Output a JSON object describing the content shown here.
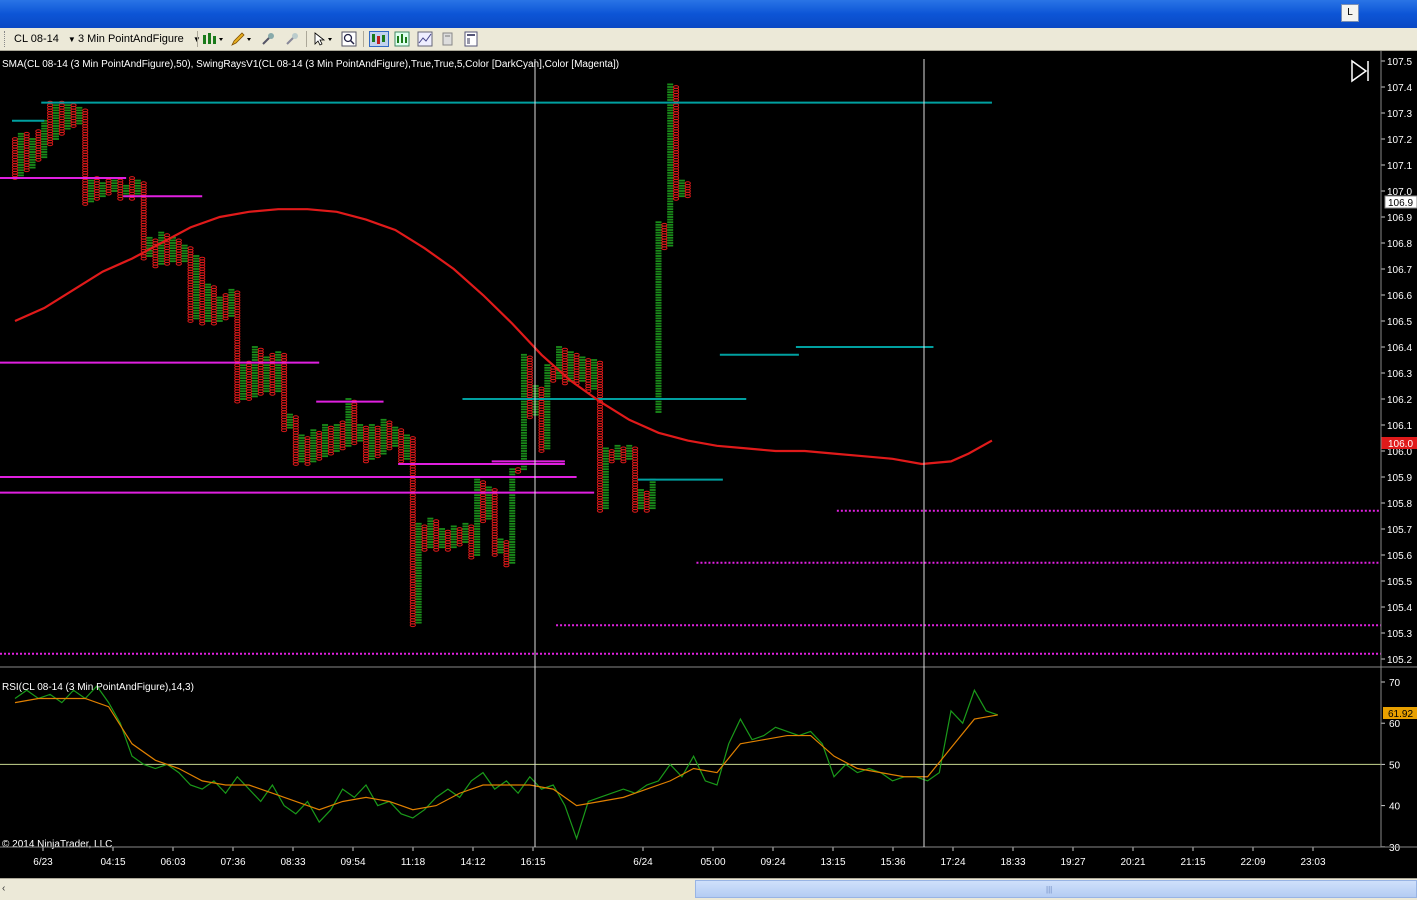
{
  "window": {
    "title_button": "L"
  },
  "toolbar": {
    "instrument": "CL 08-14",
    "period": "3 Min PointAndFigure",
    "icons": [
      "bar-chart-type-icon",
      "pencil-draw-icon",
      "crosshair-pin-icon",
      "zoom-pin-icon",
      "cursor-select-icon",
      "zoom-icon",
      "data-box-icon",
      "indicators-icon",
      "strategies-icon",
      "copy-icon",
      "properties-icon"
    ]
  },
  "price_panel": {
    "indicator_label": "SMA(CL 08-14 (3 Min PointAndFigure),50), SwingRaysV1(CL 08-14 (3 Min PointAndFigure),True,True,5,Color [DarkCyan],Color [Magenta])",
    "y_ticks": [
      "107.5",
      "107.4",
      "107.3",
      "107.2",
      "107.1",
      "107.0",
      "106.9",
      "106.8",
      "106.7",
      "106.6",
      "106.5",
      "106.4",
      "106.3",
      "106.2",
      "106.1",
      "106.0",
      "105.9",
      "105.8",
      "105.7",
      "105.6",
      "105.5",
      "105.4",
      "105.3",
      "105.2"
    ],
    "last_price_label": "106.9",
    "sma_value_label": "106.0",
    "colors": {
      "x": "#1a8c1a",
      "o": "#e01a1a",
      "sma": "#e01a1a",
      "swing_high": "#00a0a0",
      "swing_low": "#e020e0"
    }
  },
  "rsi_panel": {
    "indicator_label": "RSI(CL 08-14 (3 Min PointAndFigure),14,3)",
    "y_ticks": [
      "70",
      "60",
      "50",
      "40",
      "30"
    ],
    "value_label": "61.92",
    "colors": {
      "rsi": "#1a9a1a",
      "avg": "#e08000",
      "level": "#c8d890"
    }
  },
  "copyright": "© 2014 NinjaTrader, LLC",
  "x_axis": {
    "labels": [
      "6/23",
      "04:15",
      "06:03",
      "07:36",
      "08:33",
      "09:54",
      "11:18",
      "14:12",
      "16:15",
      "6/24",
      "05:00",
      "09:24",
      "13:15",
      "15:36",
      "17:24",
      "18:33",
      "19:27",
      "20:21",
      "21:15",
      "22:09",
      "23:03"
    ]
  },
  "chart_data": {
    "type": "point-and-figure",
    "box_size": 0.01,
    "sma_period": 50,
    "columns": [
      {
        "t": "O",
        "lo": 107.05,
        "hi": 107.2
      },
      {
        "t": "X",
        "lo": 107.06,
        "hi": 107.22
      },
      {
        "t": "O",
        "lo": 107.08,
        "hi": 107.22
      },
      {
        "t": "X",
        "lo": 107.09,
        "hi": 107.2
      },
      {
        "t": "O",
        "lo": 107.12,
        "hi": 107.23
      },
      {
        "t": "X",
        "lo": 107.13,
        "hi": 107.27
      },
      {
        "t": "O",
        "lo": 107.18,
        "hi": 107.34
      },
      {
        "t": "X",
        "lo": 107.2,
        "hi": 107.34
      },
      {
        "t": "O",
        "lo": 107.22,
        "hi": 107.34
      },
      {
        "t": "X",
        "lo": 107.24,
        "hi": 107.33
      },
      {
        "t": "O",
        "lo": 107.25,
        "hi": 107.33
      },
      {
        "t": "X",
        "lo": 107.26,
        "hi": 107.32
      },
      {
        "t": "O",
        "lo": 106.95,
        "hi": 107.31
      },
      {
        "t": "X",
        "lo": 106.96,
        "hi": 107.04
      },
      {
        "t": "O",
        "lo": 106.97,
        "hi": 107.05
      },
      {
        "t": "X",
        "lo": 106.98,
        "hi": 107.03
      },
      {
        "t": "O",
        "lo": 106.99,
        "hi": 107.04
      },
      {
        "t": "X",
        "lo": 107.0,
        "hi": 107.05
      },
      {
        "t": "O",
        "lo": 106.97,
        "hi": 107.04
      },
      {
        "t": "X",
        "lo": 106.98,
        "hi": 107.02
      },
      {
        "t": "O",
        "lo": 106.97,
        "hi": 107.05
      },
      {
        "t": "X",
        "lo": 106.98,
        "hi": 107.04
      },
      {
        "t": "O",
        "lo": 106.74,
        "hi": 107.03
      },
      {
        "t": "X",
        "lo": 106.75,
        "hi": 106.82
      },
      {
        "t": "O",
        "lo": 106.71,
        "hi": 106.81
      },
      {
        "t": "X",
        "lo": 106.72,
        "hi": 106.84
      },
      {
        "t": "O",
        "lo": 106.72,
        "hi": 106.83
      },
      {
        "t": "X",
        "lo": 106.73,
        "hi": 106.82
      },
      {
        "t": "O",
        "lo": 106.72,
        "hi": 106.81
      },
      {
        "t": "X",
        "lo": 106.73,
        "hi": 106.79
      },
      {
        "t": "O",
        "lo": 106.5,
        "hi": 106.78
      },
      {
        "t": "X",
        "lo": 106.51,
        "hi": 106.75
      },
      {
        "t": "O",
        "lo": 106.49,
        "hi": 106.74
      },
      {
        "t": "X",
        "lo": 106.5,
        "hi": 106.64
      },
      {
        "t": "O",
        "lo": 106.49,
        "hi": 106.63
      },
      {
        "t": "X",
        "lo": 106.5,
        "hi": 106.59
      },
      {
        "t": "O",
        "lo": 106.51,
        "hi": 106.6
      },
      {
        "t": "X",
        "lo": 106.52,
        "hi": 106.62
      },
      {
        "t": "O",
        "lo": 106.19,
        "hi": 106.61
      },
      {
        "t": "X",
        "lo": 106.2,
        "hi": 106.34
      },
      {
        "t": "O",
        "lo": 106.2,
        "hi": 106.34
      },
      {
        "t": "X",
        "lo": 106.21,
        "hi": 106.4
      },
      {
        "t": "O",
        "lo": 106.22,
        "hi": 106.39
      },
      {
        "t": "X",
        "lo": 106.23,
        "hi": 106.36
      },
      {
        "t": "O",
        "lo": 106.22,
        "hi": 106.37
      },
      {
        "t": "X",
        "lo": 106.23,
        "hi": 106.38
      },
      {
        "t": "O",
        "lo": 106.08,
        "hi": 106.37
      },
      {
        "t": "X",
        "lo": 106.09,
        "hi": 106.14
      },
      {
        "t": "O",
        "lo": 105.95,
        "hi": 106.13
      },
      {
        "t": "X",
        "lo": 105.96,
        "hi": 106.06
      },
      {
        "t": "O",
        "lo": 105.95,
        "hi": 106.05
      },
      {
        "t": "X",
        "lo": 105.96,
        "hi": 106.08
      },
      {
        "t": "O",
        "lo": 105.97,
        "hi": 106.07
      },
      {
        "t": "X",
        "lo": 105.98,
        "hi": 106.1
      },
      {
        "t": "O",
        "lo": 105.99,
        "hi": 106.09
      },
      {
        "t": "X",
        "lo": 106.0,
        "hi": 106.1
      },
      {
        "t": "O",
        "lo": 106.01,
        "hi": 106.11
      },
      {
        "t": "X",
        "lo": 106.02,
        "hi": 106.2
      },
      {
        "t": "O",
        "lo": 106.03,
        "hi": 106.19
      },
      {
        "t": "X",
        "lo": 106.04,
        "hi": 106.1
      },
      {
        "t": "O",
        "lo": 105.96,
        "hi": 106.09
      },
      {
        "t": "X",
        "lo": 105.97,
        "hi": 106.1
      },
      {
        "t": "O",
        "lo": 105.98,
        "hi": 106.09
      },
      {
        "t": "X",
        "lo": 105.99,
        "hi": 106.12
      },
      {
        "t": "O",
        "lo": 106.01,
        "hi": 106.11
      },
      {
        "t": "X",
        "lo": 106.02,
        "hi": 106.09
      },
      {
        "t": "O",
        "lo": 105.96,
        "hi": 106.08
      },
      {
        "t": "X",
        "lo": 105.97,
        "hi": 106.06
      },
      {
        "t": "O",
        "lo": 105.33,
        "hi": 106.05
      },
      {
        "t": "X",
        "lo": 105.34,
        "hi": 105.72
      },
      {
        "t": "O",
        "lo": 105.62,
        "hi": 105.71
      },
      {
        "t": "X",
        "lo": 105.63,
        "hi": 105.74
      },
      {
        "t": "O",
        "lo": 105.62,
        "hi": 105.73
      },
      {
        "t": "X",
        "lo": 105.63,
        "hi": 105.7
      },
      {
        "t": "O",
        "lo": 105.62,
        "hi": 105.69
      },
      {
        "t": "X",
        "lo": 105.63,
        "hi": 105.71
      },
      {
        "t": "O",
        "lo": 105.64,
        "hi": 105.7
      },
      {
        "t": "X",
        "lo": 105.65,
        "hi": 105.72
      },
      {
        "t": "O",
        "lo": 105.59,
        "hi": 105.71
      },
      {
        "t": "X",
        "lo": 105.6,
        "hi": 105.89
      },
      {
        "t": "O",
        "lo": 105.73,
        "hi": 105.88
      },
      {
        "t": "X",
        "lo": 105.74,
        "hi": 105.86
      },
      {
        "t": "O",
        "lo": 105.6,
        "hi": 105.85
      },
      {
        "t": "X",
        "lo": 105.61,
        "hi": 105.66
      },
      {
        "t": "O",
        "lo": 105.56,
        "hi": 105.65
      },
      {
        "t": "X",
        "lo": 105.57,
        "hi": 105.93
      },
      {
        "t": "O",
        "lo": 105.92,
        "hi": 105.93
      },
      {
        "t": "X",
        "lo": 105.93,
        "hi": 106.37
      },
      {
        "t": "O",
        "lo": 106.13,
        "hi": 106.36
      },
      {
        "t": "X",
        "lo": 106.14,
        "hi": 106.25
      },
      {
        "t": "O",
        "lo": 106.0,
        "hi": 106.24
      },
      {
        "t": "X",
        "lo": 106.01,
        "hi": 106.33
      },
      {
        "t": "O",
        "lo": 106.27,
        "hi": 106.32
      },
      {
        "t": "X",
        "lo": 106.28,
        "hi": 106.4
      },
      {
        "t": "O",
        "lo": 106.26,
        "hi": 106.39
      },
      {
        "t": "X",
        "lo": 106.27,
        "hi": 106.38
      },
      {
        "t": "O",
        "lo": 106.26,
        "hi": 106.37
      },
      {
        "t": "X",
        "lo": 106.27,
        "hi": 106.36
      },
      {
        "t": "O",
        "lo": 106.23,
        "hi": 106.35
      },
      {
        "t": "X",
        "lo": 106.24,
        "hi": 106.35
      },
      {
        "t": "O",
        "lo": 105.77,
        "hi": 106.34
      },
      {
        "t": "X",
        "lo": 105.78,
        "hi": 106.01
      },
      {
        "t": "O",
        "lo": 105.96,
        "hi": 106.0
      },
      {
        "t": "X",
        "lo": 105.97,
        "hi": 106.02
      },
      {
        "t": "O",
        "lo": 105.96,
        "hi": 106.01
      },
      {
        "t": "X",
        "lo": 105.97,
        "hi": 106.02
      },
      {
        "t": "O",
        "lo": 105.77,
        "hi": 106.01
      },
      {
        "t": "X",
        "lo": 105.78,
        "hi": 105.85
      },
      {
        "t": "O",
        "lo": 105.77,
        "hi": 105.84
      },
      {
        "t": "X",
        "lo": 105.78,
        "hi": 105.89
      },
      {
        "t": "X",
        "lo": 106.15,
        "hi": 106.88
      },
      {
        "t": "O",
        "lo": 106.78,
        "hi": 106.87
      },
      {
        "t": "X",
        "lo": 106.79,
        "hi": 107.41
      },
      {
        "t": "O",
        "lo": 106.97,
        "hi": 107.4
      },
      {
        "t": "X",
        "lo": 106.98,
        "hi": 107.04
      },
      {
        "t": "O",
        "lo": 106.98,
        "hi": 107.03
      }
    ],
    "swing_highs": [
      {
        "price": 107.27,
        "from": 0,
        "to": 5
      },
      {
        "price": 107.34,
        "from": 5,
        "to": 167
      },
      {
        "price": 106.2,
        "from": 77,
        "to": 125
      },
      {
        "price": 105.89,
        "from": 107,
        "to": 121
      },
      {
        "price": 106.37,
        "from": 121,
        "to": 134
      },
      {
        "price": 106.4,
        "from": 134,
        "to": 157
      }
    ],
    "swing_lows": [
      {
        "price": 107.05,
        "from": 0,
        "to": 19
      },
      {
        "price": 106.98,
        "from": 19,
        "to": 32
      },
      {
        "price": 106.34,
        "from": 0,
        "to": 52
      },
      {
        "price": 106.19,
        "from": 52,
        "to": 63
      },
      {
        "price": 105.95,
        "from": 66,
        "to": 94
      },
      {
        "price": 105.96,
        "from": 82,
        "to": 94
      },
      {
        "price": 105.9,
        "from": 0,
        "to": 96
      },
      {
        "price": 105.84,
        "from": 0,
        "to": 99
      },
      {
        "price": 105.77,
        "from": 141,
        "to": 240,
        "dotted": true
      },
      {
        "price": 105.57,
        "from": 117,
        "to": 240,
        "dotted": true
      },
      {
        "price": 105.33,
        "from": 93,
        "to": 240,
        "dotted": true
      },
      {
        "price": 105.22,
        "from": 0,
        "to": 240,
        "dotted": true
      }
    ],
    "sma": [
      [
        0,
        106.5
      ],
      [
        5,
        106.55
      ],
      [
        10,
        106.62
      ],
      [
        15,
        106.69
      ],
      [
        20,
        106.74
      ],
      [
        25,
        106.8
      ],
      [
        30,
        106.86
      ],
      [
        35,
        106.9
      ],
      [
        40,
        106.92
      ],
      [
        45,
        106.93
      ],
      [
        50,
        106.93
      ],
      [
        55,
        106.92
      ],
      [
        60,
        106.89
      ],
      [
        65,
        106.85
      ],
      [
        70,
        106.78
      ],
      [
        75,
        106.7
      ],
      [
        80,
        106.6
      ],
      [
        85,
        106.49
      ],
      [
        90,
        106.37
      ],
      [
        95,
        106.27
      ],
      [
        100,
        106.19
      ],
      [
        105,
        106.12
      ],
      [
        110,
        106.07
      ],
      [
        115,
        106.04
      ],
      [
        120,
        106.02
      ],
      [
        125,
        106.01
      ],
      [
        130,
        106.0
      ],
      [
        135,
        106.0
      ],
      [
        140,
        105.99
      ],
      [
        145,
        105.98
      ],
      [
        150,
        105.97
      ],
      [
        155,
        105.95
      ],
      [
        160,
        105.96
      ],
      [
        163,
        105.99
      ],
      [
        167,
        106.04
      ]
    ],
    "rsi": [
      [
        0,
        66
      ],
      [
        2,
        68
      ],
      [
        4,
        66
      ],
      [
        6,
        67
      ],
      [
        8,
        65
      ],
      [
        10,
        68
      ],
      [
        12,
        66
      ],
      [
        14,
        69
      ],
      [
        16,
        65
      ],
      [
        18,
        60
      ],
      [
        20,
        52
      ],
      [
        22,
        50
      ],
      [
        24,
        49
      ],
      [
        26,
        50
      ],
      [
        28,
        48
      ],
      [
        30,
        45
      ],
      [
        32,
        44
      ],
      [
        34,
        46
      ],
      [
        36,
        43
      ],
      [
        38,
        47
      ],
      [
        40,
        44
      ],
      [
        42,
        41
      ],
      [
        44,
        45
      ],
      [
        46,
        40
      ],
      [
        48,
        38
      ],
      [
        50,
        41
      ],
      [
        52,
        36
      ],
      [
        54,
        39
      ],
      [
        56,
        44
      ],
      [
        58,
        42
      ],
      [
        60,
        45
      ],
      [
        62,
        40
      ],
      [
        64,
        41
      ],
      [
        66,
        38
      ],
      [
        68,
        37
      ],
      [
        70,
        39
      ],
      [
        72,
        42
      ],
      [
        74,
        44
      ],
      [
        76,
        42
      ],
      [
        78,
        46
      ],
      [
        80,
        48
      ],
      [
        82,
        44
      ],
      [
        84,
        46
      ],
      [
        86,
        43
      ],
      [
        88,
        47
      ],
      [
        90,
        44
      ],
      [
        92,
        45
      ],
      [
        94,
        40
      ],
      [
        96,
        32
      ],
      [
        98,
        41
      ],
      [
        100,
        42
      ],
      [
        102,
        43
      ],
      [
        104,
        44
      ],
      [
        106,
        43
      ],
      [
        108,
        45
      ],
      [
        110,
        46
      ],
      [
        112,
        50
      ],
      [
        114,
        47
      ],
      [
        116,
        52
      ],
      [
        118,
        46
      ],
      [
        120,
        45
      ],
      [
        122,
        55
      ],
      [
        124,
        61
      ],
      [
        126,
        56
      ],
      [
        128,
        57
      ],
      [
        130,
        59
      ],
      [
        132,
        58
      ],
      [
        134,
        57
      ],
      [
        136,
        58
      ],
      [
        138,
        55
      ],
      [
        140,
        47
      ],
      [
        142,
        50
      ],
      [
        144,
        48
      ],
      [
        146,
        49
      ],
      [
        148,
        48
      ],
      [
        150,
        46
      ],
      [
        152,
        47
      ],
      [
        154,
        47
      ],
      [
        156,
        46
      ],
      [
        158,
        48
      ],
      [
        160,
        63
      ],
      [
        162,
        60
      ],
      [
        164,
        68
      ],
      [
        166,
        63
      ],
      [
        168,
        62
      ]
    ],
    "rsi_avg": [
      [
        0,
        65
      ],
      [
        4,
        66
      ],
      [
        8,
        66
      ],
      [
        12,
        66
      ],
      [
        16,
        64
      ],
      [
        20,
        55
      ],
      [
        24,
        51
      ],
      [
        28,
        49
      ],
      [
        32,
        46
      ],
      [
        36,
        45
      ],
      [
        40,
        45
      ],
      [
        44,
        43
      ],
      [
        48,
        41
      ],
      [
        52,
        39
      ],
      [
        56,
        41
      ],
      [
        60,
        42
      ],
      [
        64,
        41
      ],
      [
        68,
        39
      ],
      [
        72,
        40
      ],
      [
        76,
        43
      ],
      [
        80,
        45
      ],
      [
        84,
        45
      ],
      [
        88,
        45
      ],
      [
        92,
        44
      ],
      [
        96,
        40
      ],
      [
        100,
        41
      ],
      [
        104,
        42
      ],
      [
        108,
        44
      ],
      [
        112,
        46
      ],
      [
        116,
        49
      ],
      [
        120,
        48
      ],
      [
        124,
        55
      ],
      [
        128,
        56
      ],
      [
        132,
        57
      ],
      [
        136,
        57
      ],
      [
        140,
        52
      ],
      [
        144,
        49
      ],
      [
        148,
        48
      ],
      [
        152,
        47
      ],
      [
        156,
        47
      ],
      [
        160,
        54
      ],
      [
        164,
        61
      ],
      [
        168,
        62
      ]
    ]
  }
}
